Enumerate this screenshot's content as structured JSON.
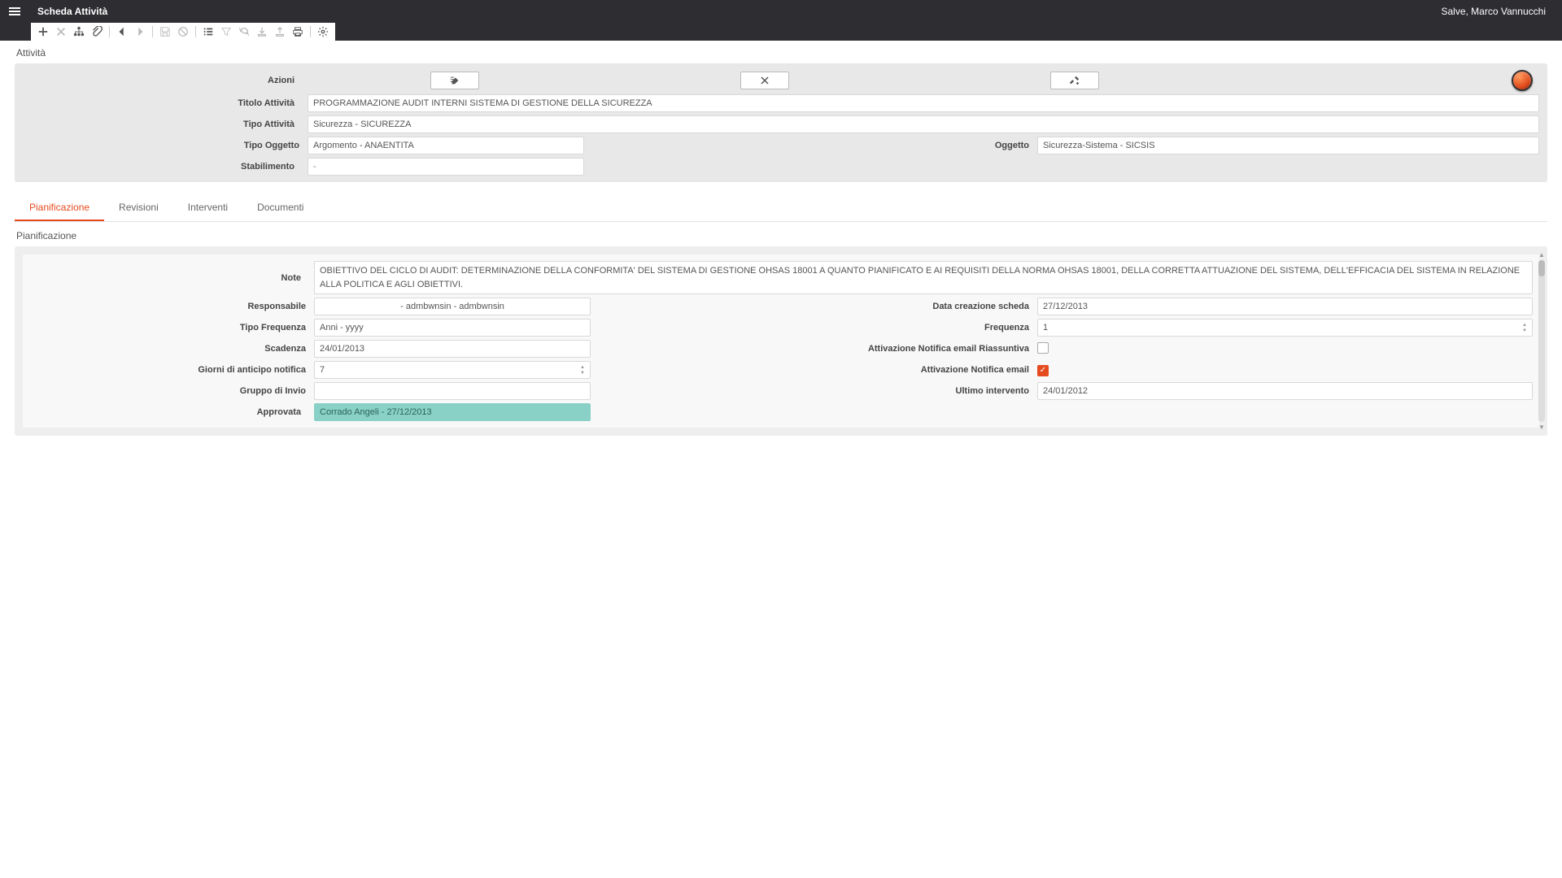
{
  "header": {
    "title": "Scheda Attività",
    "greeting": "Salve, Marco Vannucchi"
  },
  "toolbar": {
    "icons": [
      "plus",
      "close",
      "tree",
      "attach",
      "sep",
      "back",
      "forward",
      "sep",
      "save",
      "cancel",
      "sep",
      "list",
      "filter",
      "refresh",
      "export-in",
      "export-out",
      "print",
      "sep",
      "settings"
    ]
  },
  "section1": {
    "title": "Attività",
    "labels": {
      "azioni": "Azioni",
      "titolo": "Titolo Attività",
      "tipo_attivita": "Tipo Attività",
      "tipo_oggetto": "Tipo Oggetto",
      "oggetto": "Oggetto",
      "stabilimento": "Stabilimento"
    },
    "values": {
      "titolo": "PROGRAMMAZIONE AUDIT INTERNI SISTEMA DI GESTIONE DELLA SICUREZZA",
      "tipo_attivita": "Sicurezza - SICUREZZA",
      "tipo_oggetto": "Argomento - ANAENTITA",
      "oggetto": "Sicurezza-Sistema - SICSIS",
      "stabilimento": "-"
    },
    "action_icons": {
      "a": "edit-list-icon",
      "b": "x-icon",
      "c": "tools-icon"
    }
  },
  "tabs": {
    "items": [
      {
        "label": "Pianificazione",
        "active": true
      },
      {
        "label": "Revisioni",
        "active": false
      },
      {
        "label": "Interventi",
        "active": false
      },
      {
        "label": "Documenti",
        "active": false
      }
    ]
  },
  "pian": {
    "title": "Pianificazione",
    "labels": {
      "note": "Note",
      "responsabile": "Responsabile",
      "data_creazione": "Data creazione scheda",
      "tipo_frequenza": "Tipo Frequenza",
      "frequenza": "Frequenza",
      "scadenza": "Scadenza",
      "notif_riass": "Attivazione Notifica email Riassuntiva",
      "giorni_anticipo": "Giorni di anticipo notifica",
      "notif_email": "Attivazione Notifica email",
      "gruppo_invio": "Gruppo di Invio",
      "ultimo_intervento": "Ultimo intervento",
      "approvata": "Approvata"
    },
    "values": {
      "note": "OBIETTIVO DEL CICLO DI AUDIT: DETERMINAZIONE DELLA CONFORMITA' DEL SISTEMA DI GESTIONE OHSAS 18001 A QUANTO PIANIFICATO E AI REQUISITI DELLA NORMA OHSAS 18001, DELLA CORRETTA ATTUAZIONE DEL SISTEMA, DELL'EFFICACIA DEL SISTEMA IN RELAZIONE ALLA POLITICA E AGLI OBIETTIVI.",
      "responsabile": "- admbwnsin - admbwnsin",
      "data_creazione": "27/12/2013",
      "tipo_frequenza": "Anni - yyyy",
      "frequenza": "1",
      "scadenza": "24/01/2013",
      "notif_riass_checked": false,
      "giorni_anticipo": "7",
      "notif_email_checked": true,
      "gruppo_invio": "",
      "ultimo_intervento": "24/01/2012",
      "approvata": "Corrado Angeli - 27/12/2013"
    }
  }
}
